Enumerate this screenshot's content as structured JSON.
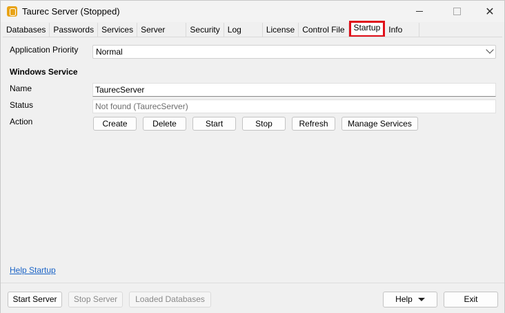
{
  "window": {
    "title": "Taurec Server (Stopped)",
    "close_glyph": "✕"
  },
  "tabs": [
    {
      "label": "Databases"
    },
    {
      "label": "Passwords"
    },
    {
      "label": "Services"
    },
    {
      "label": "Server"
    },
    {
      "label": "Security"
    },
    {
      "label": "Log"
    },
    {
      "label": "License"
    },
    {
      "label": "Control File"
    },
    {
      "label": "Startup",
      "active": true
    },
    {
      "label": "Info"
    }
  ],
  "startup": {
    "priority_label": "Application Priority",
    "priority_value": "Normal",
    "section_title": "Windows Service",
    "name_label": "Name",
    "name_value": "TaurecServer",
    "status_label": "Status",
    "status_value": "Not found (TaurecServer)",
    "action_label": "Action",
    "actions": {
      "create": "Create",
      "delete": "Delete",
      "start": "Start",
      "stop": "Stop",
      "refresh": "Refresh",
      "manage": "Manage Services"
    },
    "help_link": "Help Startup"
  },
  "footer": {
    "start_server": "Start Server",
    "stop_server": "Stop Server",
    "loaded_databases": "Loaded Databases",
    "help": "Help",
    "exit": "Exit"
  },
  "colors": {
    "highlight_border": "#e0101a",
    "link": "#1a63c6",
    "app_icon": "#e8a317"
  }
}
